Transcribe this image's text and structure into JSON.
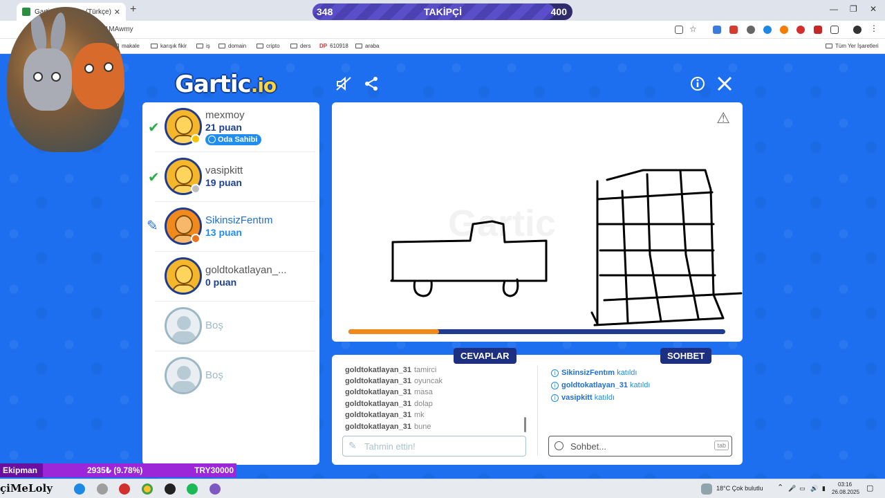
{
  "browser": {
    "tab_title": "Gartic - MAwmy (Türkçe) - Gartic",
    "url": "tic.io/011MAwmy",
    "bookmarks": [
      "makale",
      "karışık fikir",
      "iş",
      "domain",
      "cripto",
      "ders",
      "610918",
      "araba"
    ],
    "all_bookmarks": "Tüm Yer İşaretleri"
  },
  "follower": {
    "current": "348",
    "label": "TAKİPÇİ",
    "goal": "400",
    "progress": 0.93
  },
  "game": {
    "logo_main": "Gartic",
    "logo_suffix": ".io",
    "players": [
      {
        "name": "mexmoy",
        "score": "21 puan",
        "owner_label": "Oda Sahibi",
        "status": "guessed",
        "badge": "#f4c400"
      },
      {
        "name": "vasipkitt",
        "score": "19 puan",
        "status": "guessed",
        "badge": "#bdbdbd"
      },
      {
        "name": "SikinsizFentım",
        "score": "13 puan",
        "status": "drawing",
        "badge": "#e8731c"
      },
      {
        "name": "goldtokatlayan_...",
        "score": "0 puan",
        "status": "none",
        "badge": ""
      }
    ],
    "empty_slots": [
      "Boş",
      "Boş"
    ],
    "timer_progress": 0.24,
    "answers_label": "CEVAPLAR",
    "chat_label": "SOHBET",
    "answers": [
      {
        "user": "goldtokatlayan_31",
        "guess": "tamirci"
      },
      {
        "user": "goldtokatlayan_31",
        "guess": "oyuncak"
      },
      {
        "user": "goldtokatlayan_31",
        "guess": "masa"
      },
      {
        "user": "goldtokatlayan_31",
        "guess": "dolap"
      },
      {
        "user": "goldtokatlayan_31",
        "guess": "mk"
      },
      {
        "user": "goldtokatlayan_31",
        "guess": "bune"
      }
    ],
    "guess_placeholder": "Tahmin ettin!",
    "chat_events": [
      {
        "user": "SikinsizFentım",
        "action": "katıldı"
      },
      {
        "user": "goldtokatlayan_31",
        "action": "katıldı"
      },
      {
        "user": "vasipkitt",
        "action": "katıldı"
      }
    ],
    "chat_placeholder": "Sohbet...",
    "chat_key": "tab"
  },
  "ticker": {
    "label": "Ekipman",
    "value": "2935₺ (9.78%)",
    "goal": "TRY30000"
  },
  "taskbar": {
    "brand": "çiMeLoly",
    "weather": "18°C  Çok bulutlu",
    "time": "03:16",
    "date": "26.08.2025"
  }
}
